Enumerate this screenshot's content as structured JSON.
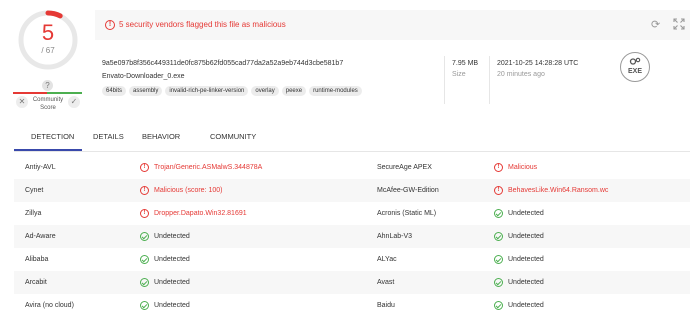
{
  "score": {
    "detections": "5",
    "total": "/ 67",
    "ratio": 0.0746
  },
  "community": {
    "label_line1": "Community",
    "label_line2": "Score",
    "help": "?"
  },
  "alert": {
    "text": "5 security vendors flagged this file as malicious"
  },
  "file": {
    "hash": "9a5e097b8f356c449311de0fc875b62fd055cad77da2a52a9eb744d3cbe581b7",
    "name": "Envato-Downloader_0.exe",
    "tags": [
      "64bits",
      "assembly",
      "invalid-rich-pe-linker-version",
      "overlay",
      "peexe",
      "runtime-modules"
    ],
    "size_value": "7.95 MB",
    "size_label": "Size",
    "date": "2021-10-25 14:28:28 UTC",
    "date_ago": "20 minutes ago",
    "type_label": "EXE"
  },
  "tabs": [
    {
      "label": "DETECTION",
      "active": true
    },
    {
      "label": "DETAILS",
      "active": false
    },
    {
      "label": "BEHAVIOR",
      "active": false
    },
    {
      "label": "COMMUNITY",
      "active": false
    }
  ],
  "detections": [
    {
      "left": {
        "vendor": "Antiy-AVL",
        "result": "Trojan/Generic.ASMalwS.344878A",
        "malicious": true
      },
      "right": {
        "vendor": "SecureAge APEX",
        "result": "Malicious",
        "malicious": true
      }
    },
    {
      "left": {
        "vendor": "Cynet",
        "result": "Malicious (score: 100)",
        "malicious": true
      },
      "right": {
        "vendor": "McAfee-GW-Edition",
        "result": "BehavesLike.Win64.Ransom.wc",
        "malicious": true
      }
    },
    {
      "left": {
        "vendor": "Zillya",
        "result": "Dropper.Dapato.Win32.81691",
        "malicious": true
      },
      "right": {
        "vendor": "Acronis (Static ML)",
        "result": "Undetected",
        "malicious": false
      }
    },
    {
      "left": {
        "vendor": "Ad-Aware",
        "result": "Undetected",
        "malicious": false
      },
      "right": {
        "vendor": "AhnLab-V3",
        "result": "Undetected",
        "malicious": false
      }
    },
    {
      "left": {
        "vendor": "Alibaba",
        "result": "Undetected",
        "malicious": false
      },
      "right": {
        "vendor": "ALYac",
        "result": "Undetected",
        "malicious": false
      }
    },
    {
      "left": {
        "vendor": "Arcabit",
        "result": "Undetected",
        "malicious": false
      },
      "right": {
        "vendor": "Avast",
        "result": "Undetected",
        "malicious": false
      }
    },
    {
      "left": {
        "vendor": "Avira (no cloud)",
        "result": "Undetected",
        "malicious": false
      },
      "right": {
        "vendor": "Baidu",
        "result": "Undetected",
        "malicious": false
      }
    }
  ],
  "colors": {
    "malicious": "#e53935",
    "clean": "#4caf50",
    "accent": "#3949ab"
  }
}
